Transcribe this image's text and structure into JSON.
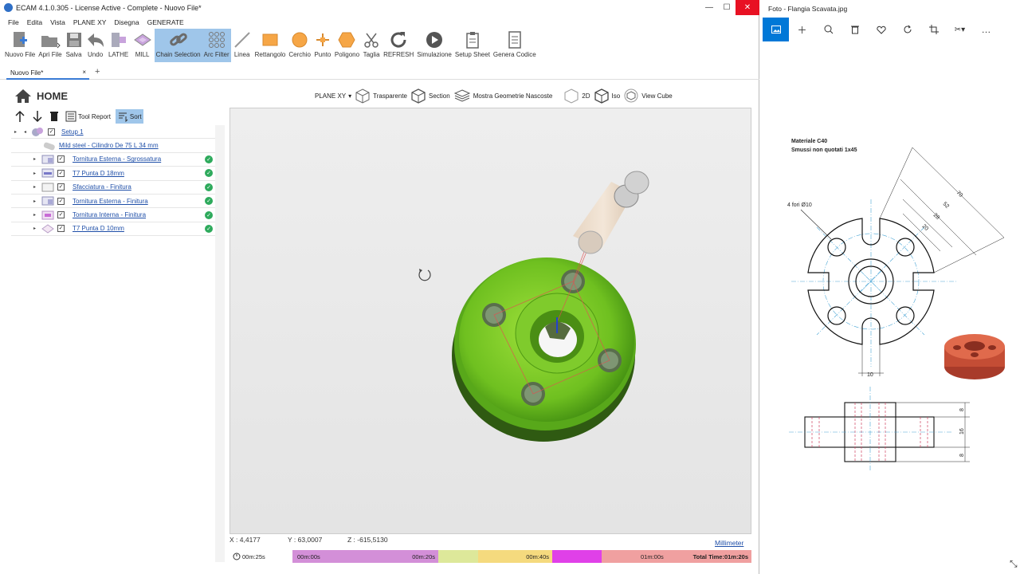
{
  "ecam": {
    "title": "ECAM 4.1.0.305 - License Active - Complete - Nuovo File*",
    "window": {
      "minimize": "—",
      "maximize": "☐",
      "close": "✕"
    },
    "menu": [
      "File",
      "Edita",
      "Vista",
      "PLANE XY",
      "Disegna",
      "GENERATE"
    ],
    "toolbar": [
      {
        "label": "Nuovo File",
        "icon": "new-file-icon"
      },
      {
        "label": "Apri File",
        "icon": "open-folder-icon"
      },
      {
        "label": "Salva",
        "icon": "save-icon"
      },
      {
        "label": "Undo",
        "icon": "undo-icon"
      },
      {
        "label": "LATHE",
        "icon": "lathe-icon"
      },
      {
        "label": "MILL",
        "icon": "mill-icon"
      },
      {
        "label": "Chain Selection",
        "icon": "chain-icon"
      },
      {
        "label": "Arc Filter",
        "icon": "arc-filter-icon"
      },
      {
        "label": "Linea",
        "icon": "line-icon"
      },
      {
        "label": "Rettangolo",
        "icon": "rectangle-icon"
      },
      {
        "label": "Cerchio",
        "icon": "circle-icon"
      },
      {
        "label": "Punto",
        "icon": "point-icon"
      },
      {
        "label": "Poligono",
        "icon": "polygon-icon"
      },
      {
        "label": "Taglia",
        "icon": "scissors-icon"
      },
      {
        "label": "REFRESH",
        "icon": "refresh-icon"
      },
      {
        "label": "Simulazione",
        "icon": "play-icon"
      },
      {
        "label": "Setup Sheet",
        "icon": "clipboard-icon"
      },
      {
        "label": "Genera Codice",
        "icon": "document-icon"
      }
    ],
    "tab": {
      "label": "Nuovo File*",
      "close": "×",
      "add": "+"
    },
    "home": "HOME",
    "treebar": {
      "tool_report": "Tool Report",
      "sort": "Sort"
    },
    "tree": [
      {
        "label": "Setup 1",
        "level": 0,
        "has_check": true,
        "status": ""
      },
      {
        "label": "Mild steel - Cilindro De 75 L 34 mm",
        "level": 1,
        "has_check": false,
        "status": ""
      },
      {
        "label": "Tornitura Esterna - Sgrossatura",
        "level": 2,
        "has_check": true,
        "status": "✓"
      },
      {
        "label": "T7 Punta D 18mm",
        "level": 2,
        "has_check": true,
        "status": "✓"
      },
      {
        "label": "Sfacciatura - Finitura",
        "level": 2,
        "has_check": true,
        "status": "✓"
      },
      {
        "label": "Tornitura Esterna - Finitura",
        "level": 2,
        "has_check": true,
        "status": "✓"
      },
      {
        "label": "Tornitura Interna - Finitura",
        "level": 2,
        "has_check": true,
        "status": "✓"
      },
      {
        "label": "T7 Punta D 10mm",
        "level": 2,
        "has_check": true,
        "status": "✓"
      }
    ],
    "viewtools": {
      "plane": "PLANE XY",
      "transparent": "Trasparente",
      "section": "Section",
      "hidden": "Mostra Geometrie Nascoste",
      "view2d": "2D",
      "iso": "Iso",
      "cube": "View Cube"
    },
    "coords": {
      "x": "X : 4,4177",
      "y": "Y : 63,0007",
      "z": "Z : -615,5130",
      "unit": "Millimeter"
    },
    "timeline": {
      "elapsed": "00m:25s",
      "segments": [
        {
          "label": "00m:00s",
          "color": "#d38fd8",
          "end_label": "00m:20s"
        },
        {
          "label": "",
          "color": "#dde89a"
        },
        {
          "label": "00m:40s",
          "color": "#f5da7e"
        },
        {
          "label": "",
          "color": "#e040e8"
        },
        {
          "label": "01m:00s",
          "color": "#f0a0a0"
        }
      ],
      "total": "Total Time:01m:20s"
    }
  },
  "foto": {
    "title": "Foto - Flangia Scavata.jpg",
    "tools": [
      "image-icon",
      "add-icon",
      "zoom-icon",
      "delete-icon",
      "heart-icon",
      "rotate-icon",
      "crop-icon",
      "edit-icon",
      "more-icon"
    ],
    "drawing": {
      "note1": "Materiale C40",
      "note2": "Smussi non quotati 1x45",
      "holes": "4 fori Ø10",
      "dims": [
        "70",
        "52",
        "28",
        "20",
        "10",
        "8",
        "16",
        "8"
      ]
    }
  }
}
